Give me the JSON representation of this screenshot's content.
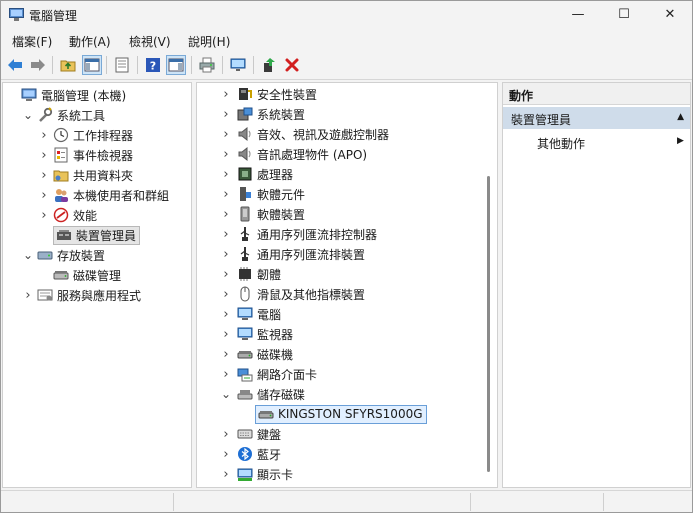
{
  "window": {
    "title": "電腦管理",
    "controls": {
      "minimize": "—",
      "maximize": "☐",
      "close": "✕"
    }
  },
  "menu": [
    "檔案(F)",
    "動作(A)",
    "檢視(V)",
    "說明(H)"
  ],
  "left_tree": [
    {
      "label": "電腦管理 (本機)",
      "icon": "computer-management-icon",
      "level": 0,
      "chevron": ""
    },
    {
      "label": "系統工具",
      "icon": "system-tools-icon",
      "level": 1,
      "chevron": "expanded"
    },
    {
      "label": "工作排程器",
      "icon": "clock-icon",
      "level": 2,
      "chevron": "collapsed"
    },
    {
      "label": "事件檢視器",
      "icon": "event-viewer-icon",
      "level": 2,
      "chevron": "collapsed"
    },
    {
      "label": "共用資料夾",
      "icon": "shared-folder-icon",
      "level": 2,
      "chevron": "collapsed"
    },
    {
      "label": "本機使用者和群組",
      "icon": "users-icon",
      "level": 2,
      "chevron": "collapsed"
    },
    {
      "label": "效能",
      "icon": "performance-icon",
      "level": 2,
      "chevron": "collapsed"
    },
    {
      "label": "裝置管理員",
      "icon": "device-manager-icon",
      "level": 2,
      "chevron": "",
      "selected": true
    },
    {
      "label": "存放裝置",
      "icon": "storage-icon",
      "level": 1,
      "chevron": "expanded"
    },
    {
      "label": "磁碟管理",
      "icon": "disk-management-icon",
      "level": 2,
      "chevron": ""
    },
    {
      "label": "服務與應用程式",
      "icon": "services-icon",
      "level": 1,
      "chevron": "collapsed"
    }
  ],
  "device_tree": [
    {
      "label": "安全性裝置",
      "icon": "security-device-icon",
      "chevron": "collapsed"
    },
    {
      "label": "系統裝置",
      "icon": "system-device-icon",
      "chevron": "collapsed"
    },
    {
      "label": "音效、視訊及遊戲控制器",
      "icon": "speaker-icon",
      "chevron": "collapsed"
    },
    {
      "label": "音訊處理物件 (APO)",
      "icon": "speaker-icon",
      "chevron": "collapsed"
    },
    {
      "label": "處理器",
      "icon": "processor-icon",
      "chevron": "collapsed"
    },
    {
      "label": "軟體元件",
      "icon": "software-component-icon",
      "chevron": "collapsed"
    },
    {
      "label": "軟體裝置",
      "icon": "software-device-icon",
      "chevron": "collapsed"
    },
    {
      "label": "通用序列匯流排控制器",
      "icon": "usb-icon",
      "chevron": "collapsed"
    },
    {
      "label": "通用序列匯流排裝置",
      "icon": "usb-icon",
      "chevron": "collapsed"
    },
    {
      "label": "韌體",
      "icon": "firmware-icon",
      "chevron": "collapsed"
    },
    {
      "label": "滑鼠及其他指標裝置",
      "icon": "mouse-icon",
      "chevron": "collapsed"
    },
    {
      "label": "電腦",
      "icon": "monitor-icon",
      "chevron": "collapsed"
    },
    {
      "label": "監視器",
      "icon": "monitor-icon",
      "chevron": "collapsed"
    },
    {
      "label": "磁碟機",
      "icon": "disk-drive-icon",
      "chevron": "collapsed"
    },
    {
      "label": "網路介面卡",
      "icon": "network-adapter-icon",
      "chevron": "collapsed"
    },
    {
      "label": "儲存磁碟",
      "icon": "storage-disk-icon",
      "chevron": "expanded"
    },
    {
      "label": "KINGSTON SFYRS1000G",
      "icon": "disk-drive-icon",
      "chevron": "",
      "child": true,
      "selected": true
    },
    {
      "label": "鍵盤",
      "icon": "keyboard-icon",
      "chevron": "collapsed"
    },
    {
      "label": "藍牙",
      "icon": "bluetooth-icon",
      "chevron": "collapsed"
    },
    {
      "label": "顯示卡",
      "icon": "display-adapter-icon",
      "chevron": "collapsed"
    }
  ],
  "actions": {
    "header": "動作",
    "section": "裝置管理員",
    "item": "其他動作"
  },
  "colors": {
    "accent": "#0067c0",
    "selection": "#e1efff",
    "section": "#cfdcea"
  }
}
